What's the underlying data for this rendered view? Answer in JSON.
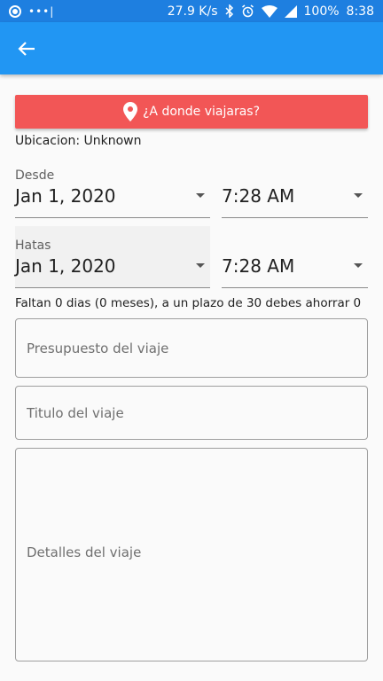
{
  "status_bar": {
    "speed": "27.9 K/s",
    "battery": "100%",
    "time": "8:38",
    "dots": "•••|"
  },
  "app_bar": {
    "back_icon": "arrow-left-icon"
  },
  "location_button": {
    "label": "¿A donde viajaras?",
    "icon": "location-pin-icon"
  },
  "ubicacion": "Ubicacion: Unknown",
  "desde": {
    "label": "Desde",
    "date": "Jan 1, 2020",
    "time": "7:28 AM"
  },
  "hatas": {
    "label": "Hatas",
    "date": "Jan 1, 2020",
    "time": "7:28 AM"
  },
  "summary": "Faltan 0 dias (0 meses), a un plazo de 30 debes ahorrar 0",
  "fields": {
    "budget_placeholder": "Presupuesto del viaje",
    "title_placeholder": "Titulo del viaje",
    "details_placeholder": "Detalles del viaje"
  },
  "colors": {
    "status_bar": "#1e7fe0",
    "app_bar": "#2196f3",
    "location_button": "#f25656"
  }
}
